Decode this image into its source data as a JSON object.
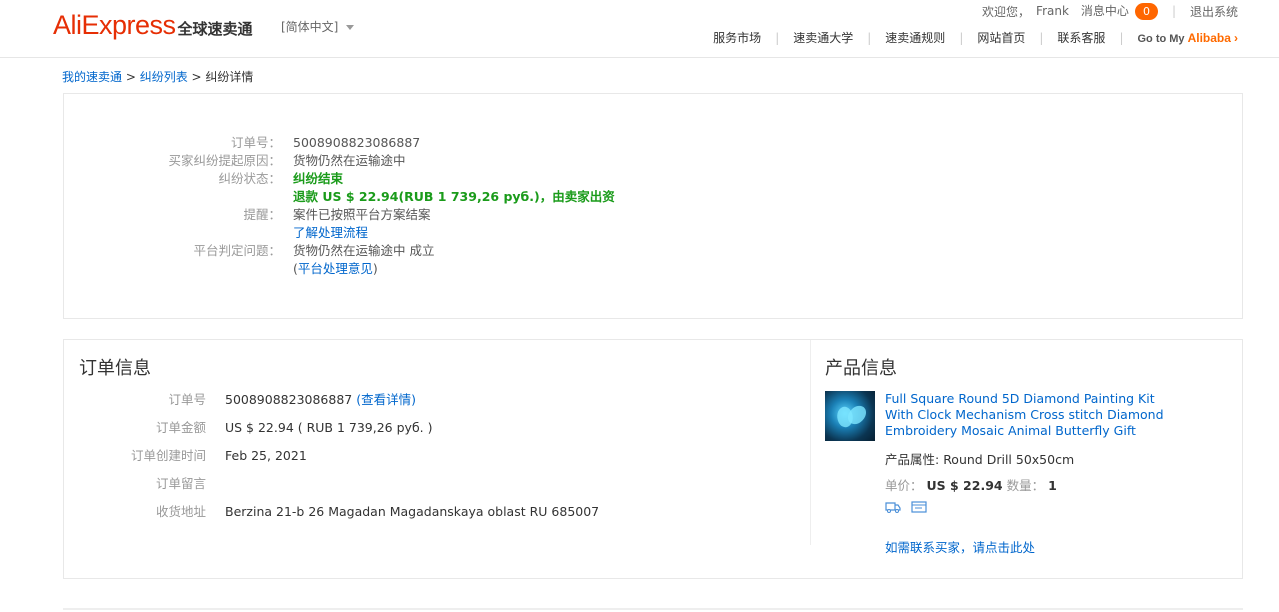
{
  "header": {
    "logo_text": "AliExpress",
    "logo_cn": "全球速卖通",
    "language": "[简体中文]",
    "welcome": "欢迎您，",
    "username": "Frank",
    "messages_label": "消息中心",
    "messages_count": "0",
    "logout": "退出系统",
    "nav": [
      "服务市场",
      "速卖通大学",
      "速卖通规则",
      "网站首页",
      "联系客服"
    ],
    "goto_prefix": "Go to My ",
    "goto_brand": "Alibaba",
    "goto_arrow": "›"
  },
  "breadcrumb": {
    "item1": "我的速卖通",
    "sep": " > ",
    "item2": "纠纷列表",
    "item3": "纠纷详情"
  },
  "dispute": {
    "order_no_label": "订单号：",
    "order_no": "5008908823086887",
    "reason_label": "买家纠纷提起原因：",
    "reason": "货物仍然在运输途中",
    "status_label": "纠纷状态：",
    "status": "纠纷结束",
    "refund": "退款 US $ 22.94(RUB 1 739,26 руб.)，由卖家出资",
    "reminder_label": "提醒：",
    "reminder": "案件已按照平台方案结案",
    "process_link": "了解处理流程",
    "verdict_label": "平台判定问题：",
    "verdict": "货物仍然在运输途中 成立",
    "opinion_link_prefix": "(",
    "opinion_link": "平台处理意见",
    "opinion_link_suffix": ")"
  },
  "order_info": {
    "title": "订单信息",
    "order_no_label": "订单号",
    "order_no": "5008908823086887",
    "detail_link": "(查看详情)",
    "amount_label": "订单金额",
    "amount": "US $ 22.94 ( RUB 1 739,26 руб. )",
    "created_label": "订单创建时间",
    "created": "Feb 25, 2021",
    "note_label": "订单留言",
    "note": "",
    "address_label": "收货地址",
    "address": "Berzina 21-b 26 Magadan Magadanskaya oblast RU 685007"
  },
  "product_info": {
    "title": "产品信息",
    "name": "Full Square Round 5D Diamond Painting Kit With Clock Mechanism Cross stitch Diamond Embroidery Mosaic Animal Butterfly Gift",
    "attr_label": "产品属性: ",
    "attr": "Round Drill 50x50cm",
    "price_label": "单价：",
    "price": "US $ 22.94",
    "qty_label": "数量：",
    "qty": "1",
    "contact_link": "如需联系买家，请点击此处"
  },
  "colors": {
    "brand": "#e62e04",
    "link": "#0066cc",
    "success": "#1a9b1a",
    "badge": "#ff6600"
  }
}
